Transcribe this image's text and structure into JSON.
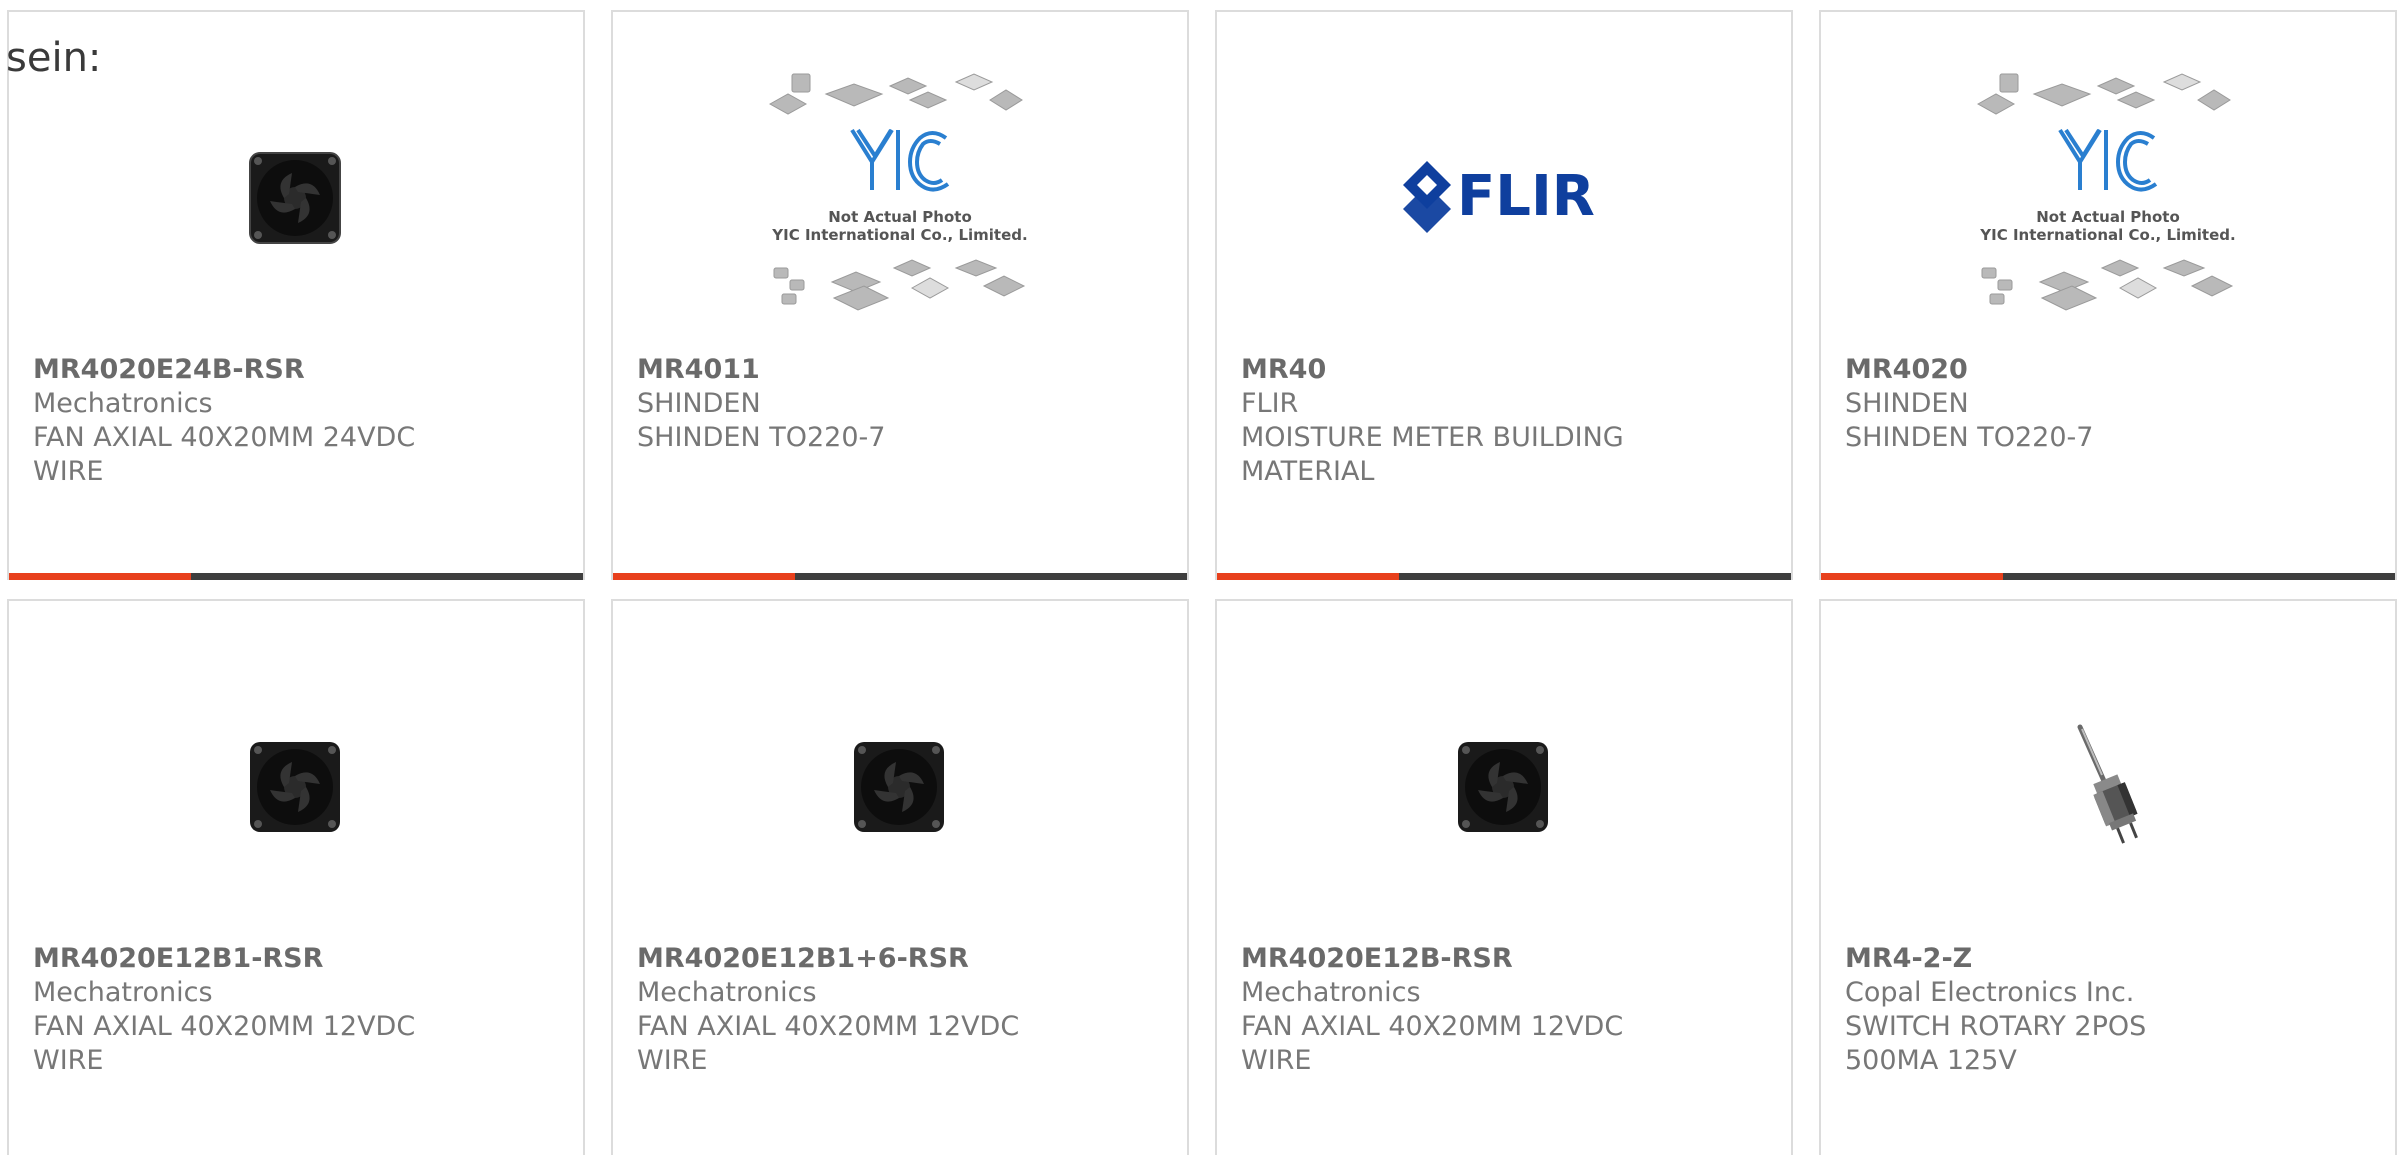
{
  "heading": "sein:",
  "colors": {
    "accent": "#e8401c",
    "bar": "#3e3e3e",
    "border": "#dcdcdc",
    "text": "#777777",
    "flir_blue": "#0f3f9e"
  },
  "products": [
    {
      "part_number": "MR4020E24B-RSR",
      "manufacturer": "Mechatronics",
      "description": "FAN AXIAL 40X20MM 24VDC WIRE",
      "image": "fan-icon"
    },
    {
      "part_number": "MR4011",
      "manufacturer": "SHINDEN",
      "description": "SHINDEN TO220-7",
      "image": "yic-placeholder",
      "image_caption_1": "Not Actual Photo",
      "image_caption_2": "YIC International Co., Limited."
    },
    {
      "part_number": "MR40",
      "manufacturer": "FLIR",
      "description": "MOISTURE METER BUILDING MATERIAL",
      "image": "flir-logo",
      "logo_text": "FLIR"
    },
    {
      "part_number": "MR4020",
      "manufacturer": "SHINDEN",
      "description": "SHINDEN TO220-7",
      "image": "yic-placeholder",
      "image_caption_1": "Not Actual Photo",
      "image_caption_2": "YIC International Co., Limited."
    },
    {
      "part_number": "MR4020E12B1-RSR",
      "manufacturer": "Mechatronics",
      "description": "FAN AXIAL 40X20MM 12VDC WIRE",
      "image": "fan-icon"
    },
    {
      "part_number": "MR4020E12B1+6-RSR",
      "manufacturer": "Mechatronics",
      "description": "FAN AXIAL 40X20MM 12VDC WIRE",
      "image": "fan-icon"
    },
    {
      "part_number": "MR4020E12B-RSR",
      "manufacturer": "Mechatronics",
      "description": "FAN AXIAL 40X20MM 12VDC WIRE",
      "image": "fan-icon"
    },
    {
      "part_number": "MR4-2-Z",
      "manufacturer": "Copal Electronics Inc.",
      "description": "SWITCH ROTARY 2POS 500MA 125V",
      "image": "rotary-switch-icon"
    }
  ]
}
